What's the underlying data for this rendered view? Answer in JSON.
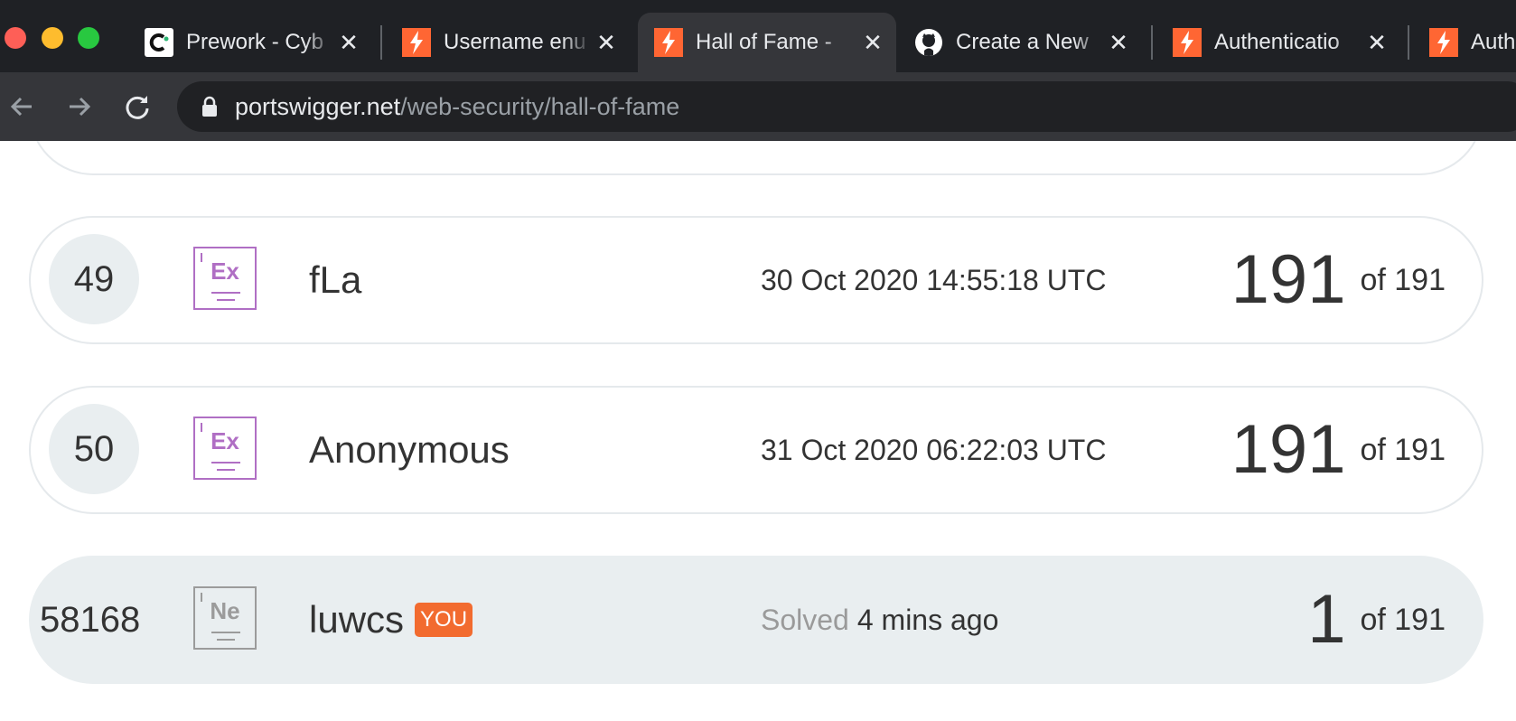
{
  "browser": {
    "tabs": [
      {
        "title": "Prework - Cyb",
        "favicon": "codepath-icon",
        "active": false
      },
      {
        "title": "Username enu",
        "favicon": "portswigger-icon",
        "active": false
      },
      {
        "title": "Hall of Fame -",
        "favicon": "portswigger-icon",
        "active": true
      },
      {
        "title": "Create a New",
        "favicon": "github-icon",
        "active": false
      },
      {
        "title": "Authenticatio",
        "favicon": "portswigger-icon",
        "active": false
      },
      {
        "title": "Auth",
        "favicon": "portswigger-icon",
        "active": false
      }
    ],
    "close_glyph": "✕",
    "url": {
      "host": "portswigger.net",
      "path": "/web-security/hall-of-fame"
    }
  },
  "leaderboard": {
    "rows": [
      {
        "rank": "49",
        "badge": "Ex",
        "name": "fLa",
        "date_prefix": "",
        "date": "30 Oct 2020 14:55:18 UTC",
        "score": "191",
        "of": "of 191",
        "is_you": false
      },
      {
        "rank": "50",
        "badge": "Ex",
        "name": "Anonymous",
        "date_prefix": "",
        "date": "31 Oct 2020 06:22:03 UTC",
        "score": "191",
        "of": "of 191",
        "is_you": false
      },
      {
        "rank": "58168",
        "badge": "Ne",
        "name": "luwcs",
        "you_label": "YOU",
        "date_prefix": "Solved",
        "date": "4 mins ago",
        "score": "1",
        "of": "of 191",
        "is_you": true
      }
    ]
  },
  "colors": {
    "accent": "#f26b2f",
    "expert_badge": "#b06fc4",
    "novice_badge": "#9b9b9b"
  }
}
